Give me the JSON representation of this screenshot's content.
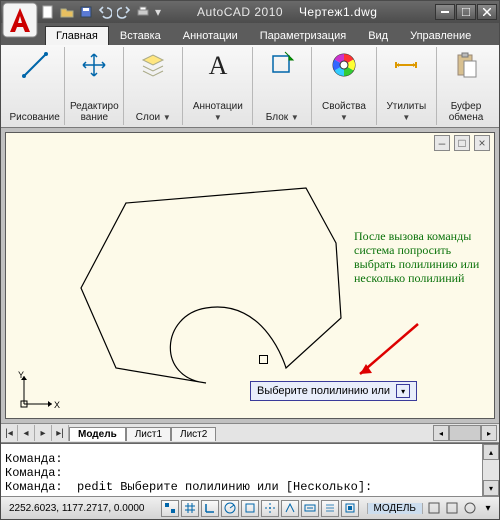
{
  "title": {
    "app": "AutoCAD 2010",
    "doc": "Чертеж1.dwg"
  },
  "qat_icons": [
    "new",
    "open",
    "save",
    "undo",
    "redo",
    "print",
    "more"
  ],
  "tabs": [
    {
      "label": "Главная",
      "active": true
    },
    {
      "label": "Вставка"
    },
    {
      "label": "Аннотации"
    },
    {
      "label": "Параметризация"
    },
    {
      "label": "Вид"
    },
    {
      "label": "Управление"
    }
  ],
  "panels": [
    {
      "label": "Рисование",
      "icon": "line"
    },
    {
      "label": "Редактиро\nвание",
      "icon": "move"
    },
    {
      "label": "Слои",
      "icon": "layers"
    },
    {
      "label": "Аннотации",
      "icon": "text"
    },
    {
      "label": "Блок",
      "icon": "block"
    },
    {
      "label": "Свойства",
      "icon": "color"
    },
    {
      "label": "Утилиты",
      "icon": "measure"
    },
    {
      "label": "Буфер\nобмена",
      "icon": "clipboard"
    }
  ],
  "prompt": "Выберите полилинию или",
  "annotation": "После вызова команды система попросить выбрать полилинию или несколько полилиний",
  "layout_tabs": [
    "Модель",
    "Лист1",
    "Лист2"
  ],
  "command_lines": [
    "Команда:",
    "Команда:",
    "",
    "Команда:  pedit Выберите полилинию или [Несколько]:"
  ],
  "status": {
    "coords": "2252.6023, 1177.2717, 0.0000",
    "space": "МОДЕЛЬ"
  }
}
